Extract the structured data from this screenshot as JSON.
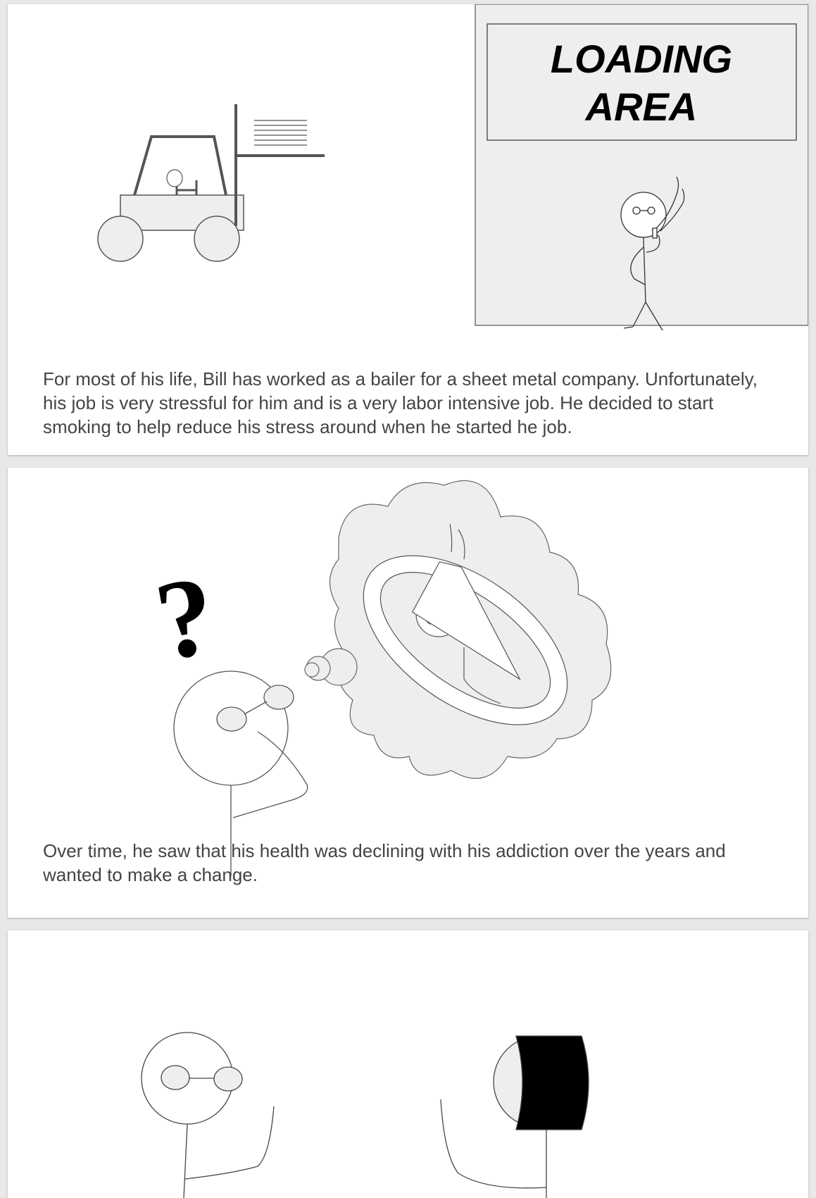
{
  "slides": [
    {
      "sign": {
        "line1": "LOADING",
        "line2": "AREA"
      },
      "caption": "For most of his life, Bill has worked as a bailer for a sheet metal company. Unfortunately, his job is very stressful for him and is a very labor intensive job. He decided to start smoking to help reduce his stress around when he started he job."
    },
    {
      "caption": "Over time, he saw that his health was declining with his addiction over the years and wanted to make a change."
    },
    {
      "caption": ""
    }
  ],
  "colors": {
    "canvas": "#e8e8e8",
    "slide": "#ffffff",
    "panel_fill": "#eeeeee",
    "caption_text": "#444444",
    "forklift_stroke": "#555555"
  },
  "icons": [
    "forklift-icon",
    "smoking-stick-figure-icon",
    "question-mark-icon",
    "thought-bubble-icon",
    "no-smoking-symbol-icon",
    "stick-figure-icon"
  ]
}
